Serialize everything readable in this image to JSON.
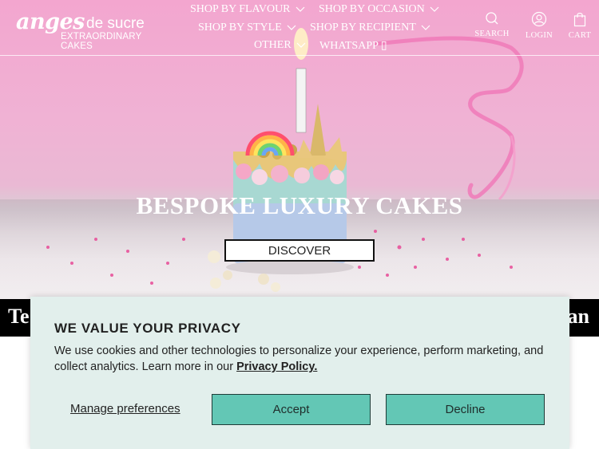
{
  "brand": {
    "logo_script": "anges",
    "logo_line1": "de sucre",
    "logo_line2": "EXTRAORDINARY CAKES"
  },
  "nav": {
    "items": [
      {
        "label": "SHOP BY FLAVOUR",
        "has_dropdown": true
      },
      {
        "label": "SHOP BY OCCASION",
        "has_dropdown": true
      },
      {
        "label": "SHOP BY STYLE",
        "has_dropdown": true
      },
      {
        "label": "SHOP BY RECIPIENT",
        "has_dropdown": true
      },
      {
        "label": "OTHER",
        "has_dropdown": true
      },
      {
        "label": "WHATSAPP ▯",
        "has_dropdown": false
      }
    ]
  },
  "header_utils": {
    "search": {
      "label": "SEARCH",
      "icon": "search-icon"
    },
    "login": {
      "label": "LOGIN",
      "icon": "user-icon"
    },
    "cart": {
      "label": "CART",
      "icon": "cart-bag-icon"
    }
  },
  "hero": {
    "title": "BESPOKE LUXURY CAKES",
    "button_label": "DISCOVER"
  },
  "press": {
    "left_fragment": "Te",
    "right_fragment": "an"
  },
  "cookie_banner": {
    "title": "WE VALUE YOUR PRIVACY",
    "body": "We use cookies and other technologies to personalize your experience, perform marketing, and collect analytics. Learn more in our ",
    "policy_link": "Privacy Policy.",
    "manage_label": "Manage preferences",
    "accept_label": "Accept",
    "decline_label": "Decline"
  },
  "colors": {
    "hero_pink": "#f3a6cf",
    "banner_bg": "#e2efec",
    "button_teal": "#63c7b5",
    "press_bg": "#000000"
  }
}
